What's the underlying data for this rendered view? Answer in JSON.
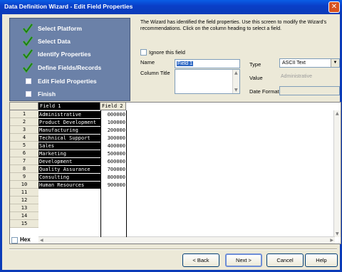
{
  "window": {
    "title": "Data Definition Wizard - Edit Field Properties"
  },
  "steps": [
    {
      "label": "Select Platform",
      "state": "done"
    },
    {
      "label": "Select Data",
      "state": "done"
    },
    {
      "label": "Identify Properties",
      "state": "done"
    },
    {
      "label": "Define Fields/Records",
      "state": "done"
    },
    {
      "label": "Edit Field Properties",
      "state": "current"
    },
    {
      "label": "Finish",
      "state": "pending"
    }
  ],
  "description": "The Wizard has identified the field properties. Use this screen to modify the Wizard's recommendations. Click on the column heading to select a field.",
  "form": {
    "ignore_label": "Ignore this field",
    "name_label": "Name",
    "name_value": "Field 1",
    "type_label": "Type",
    "type_value": "ASCII Text",
    "column_title_label": "Column Title",
    "value_label": "Value",
    "value_value": "Administrative",
    "date_format_label": "Date Format"
  },
  "grid": {
    "headers": [
      "Field 1",
      "Field 2"
    ],
    "rows": [
      {
        "num": "1",
        "f1": "Administrative",
        "f2": "000000"
      },
      {
        "num": "2",
        "f1": "Product Development",
        "f2": "100000"
      },
      {
        "num": "3",
        "f1": "Manufacturing",
        "f2": "200000"
      },
      {
        "num": "4",
        "f1": "Technical Support",
        "f2": "300000"
      },
      {
        "num": "5",
        "f1": "Sales",
        "f2": "400000"
      },
      {
        "num": "6",
        "f1": "Marketing",
        "f2": "500000"
      },
      {
        "num": "7",
        "f1": "Development",
        "f2": "600000"
      },
      {
        "num": "8",
        "f1": "Quality Assurance",
        "f2": "700000"
      },
      {
        "num": "9",
        "f1": "Consulting",
        "f2": "800000"
      },
      {
        "num": "10",
        "f1": "Human Resources",
        "f2": "900000"
      },
      {
        "num": "11",
        "f1": "",
        "f2": ""
      },
      {
        "num": "12",
        "f1": "",
        "f2": ""
      },
      {
        "num": "13",
        "f1": "",
        "f2": ""
      },
      {
        "num": "14",
        "f1": "",
        "f2": ""
      },
      {
        "num": "15",
        "f1": "",
        "f2": ""
      }
    ]
  },
  "hex_label": "Hex",
  "buttons": {
    "back": "< Back",
    "next": "Next >",
    "cancel": "Cancel",
    "help": "Help"
  }
}
